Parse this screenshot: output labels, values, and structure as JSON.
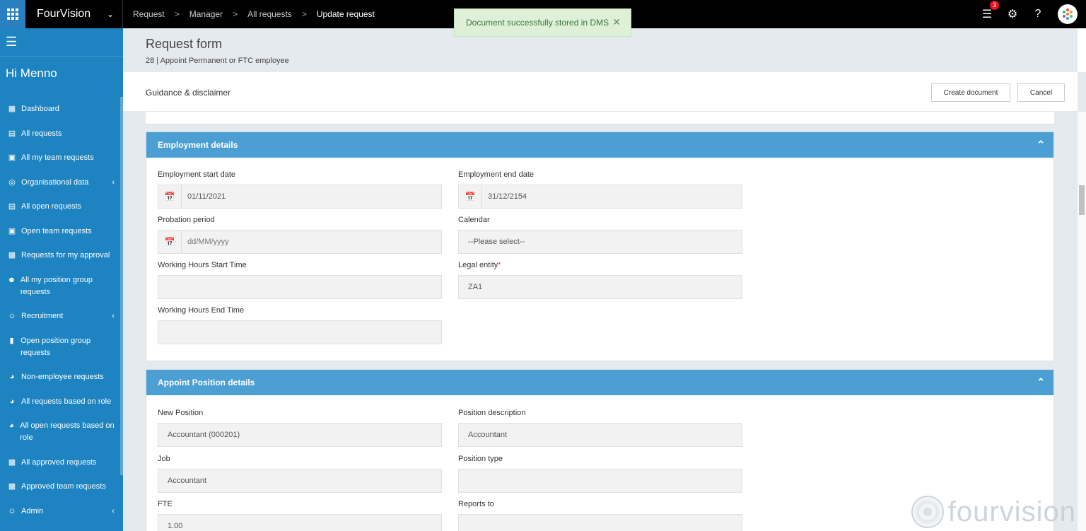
{
  "app": {
    "name": "FourVision"
  },
  "breadcrumb": [
    "Request",
    "Manager",
    "All requests",
    "Update request"
  ],
  "notifications": {
    "count": "3"
  },
  "toast": {
    "message": "Document successfully stored in DMS"
  },
  "sidebar": {
    "greeting": "Hi Menno",
    "items": [
      {
        "label": "Dashboard",
        "icon": "dashboard-icon",
        "submenu": false
      },
      {
        "label": "All requests",
        "icon": "requests-icon",
        "submenu": false
      },
      {
        "label": "All my team requests",
        "icon": "team-icon",
        "submenu": false
      },
      {
        "label": "Organisational data",
        "icon": "globe-icon",
        "submenu": true
      },
      {
        "label": "All open requests",
        "icon": "requests-icon",
        "submenu": false
      },
      {
        "label": "Open team requests",
        "icon": "team-icon",
        "submenu": false
      },
      {
        "label": "Requests for my approval",
        "icon": "approval-icon",
        "submenu": false
      },
      {
        "label": "All my position group requests",
        "icon": "people-icon",
        "submenu": false
      },
      {
        "label": "Recruitment",
        "icon": "recruit-icon",
        "submenu": true
      },
      {
        "label": "Open position group requests",
        "icon": "clipboard-icon",
        "submenu": false
      },
      {
        "label": "Non-employee requests",
        "icon": "head-icon",
        "submenu": false
      },
      {
        "label": "All requests based on role",
        "icon": "head-icon",
        "submenu": false
      },
      {
        "label": "All open requests based on role",
        "icon": "head-icon",
        "submenu": false
      },
      {
        "label": "All approved requests",
        "icon": "approval-icon",
        "submenu": false
      },
      {
        "label": "Approved team requests",
        "icon": "approval-icon",
        "submenu": false
      },
      {
        "label": "Admin",
        "icon": "admin-icon",
        "submenu": true
      }
    ]
  },
  "page": {
    "title": "Request form",
    "subtitle": "28 | Appoint Permanent or FTC employee",
    "guidance": "Guidance & disclaimer",
    "create_label": "Create document",
    "cancel_label": "Cancel"
  },
  "employment": {
    "title": "Employment details",
    "start_date": {
      "label": "Employment start date",
      "value": "01/11/2021"
    },
    "end_date": {
      "label": "Employment end date",
      "value": "31/12/2154"
    },
    "probation": {
      "label": "Probation period",
      "placeholder": "dd/MM/yyyy"
    },
    "calendar": {
      "label": "Calendar",
      "value": "--Please select--"
    },
    "wh_start": {
      "label": "Working Hours Start Time",
      "value": ""
    },
    "legal_entity": {
      "label": "Legal entity",
      "required_mark": "*",
      "value": "ZA1"
    },
    "wh_end": {
      "label": "Working Hours End Time",
      "value": ""
    }
  },
  "position": {
    "title": "Appoint Position details",
    "new_position": {
      "label": "New Position",
      "value": "Accountant (000201)"
    },
    "description": {
      "label": "Position description",
      "value": "Accountant"
    },
    "job": {
      "label": "Job",
      "value": "Accountant"
    },
    "type": {
      "label": "Position type",
      "value": ""
    },
    "fte": {
      "label": "FTE",
      "value": "1.00"
    },
    "reports_to": {
      "label": "Reports to",
      "value": ""
    }
  },
  "watermark": {
    "text": "fourvision"
  }
}
